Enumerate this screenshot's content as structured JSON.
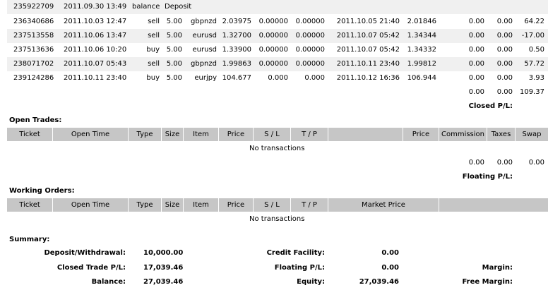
{
  "closed_trades": [
    {
      "ticket": "235922709",
      "open_time": "2011.09.30 13:49",
      "type": "balance",
      "size": "Deposit",
      "item": "",
      "price": "",
      "sl": "",
      "tp": "",
      "close_time": "",
      "close_price": "",
      "commission": "",
      "taxes": "",
      "swap": "",
      "profit": ""
    },
    {
      "ticket": "236340686",
      "open_time": "2011.10.03 12:47",
      "type": "sell",
      "size": "5.00",
      "item": "gbpnzd",
      "price": "2.03975",
      "sl": "0.00000",
      "tp": "0.00000",
      "close_time": "2011.10.05 21:40",
      "close_price": "2.01846",
      "commission": "0.00",
      "taxes": "0.00",
      "swap": "64.22"
    },
    {
      "ticket": "237513558",
      "open_time": "2011.10.06 13:47",
      "type": "sell",
      "size": "5.00",
      "item": "eurusd",
      "price": "1.32700",
      "sl": "0.00000",
      "tp": "0.00000",
      "close_time": "2011.10.07 05:42",
      "close_price": "1.34344",
      "commission": "0.00",
      "taxes": "0.00",
      "swap": "-17.00"
    },
    {
      "ticket": "237513636",
      "open_time": "2011.10.06 10:20",
      "type": "buy",
      "size": "5.00",
      "item": "eurusd",
      "price": "1.33900",
      "sl": "0.00000",
      "tp": "0.00000",
      "close_time": "2011.10.07 05:42",
      "close_price": "1.34332",
      "commission": "0.00",
      "taxes": "0.00",
      "swap": "0.50"
    },
    {
      "ticket": "238071702",
      "open_time": "2011.10.07 05:43",
      "type": "sell",
      "size": "5.00",
      "item": "gbpnzd",
      "price": "1.99863",
      "sl": "0.00000",
      "tp": "0.00000",
      "close_time": "2011.10.11 23:40",
      "close_price": "1.99812",
      "commission": "0.00",
      "taxes": "0.00",
      "swap": "57.72"
    },
    {
      "ticket": "239124286",
      "open_time": "2011.10.11 23:40",
      "type": "buy",
      "size": "5.00",
      "item": "eurjpy",
      "price": "104.677",
      "sl": "0.000",
      "tp": "0.000",
      "close_time": "2011.10.12 16:36",
      "close_price": "106.944",
      "commission": "0.00",
      "taxes": "0.00",
      "swap": "3.93"
    }
  ],
  "closed_totals": {
    "commission": "0.00",
    "taxes": "0.00",
    "swap": "109.37",
    "label": "Closed P/L:"
  },
  "open_trades": {
    "title": "Open Trades:",
    "headers": {
      "ticket": "Ticket",
      "open_time": "Open Time",
      "type": "Type",
      "size": "Size",
      "item": "Item",
      "price": "Price",
      "sl": "S / L",
      "tp": "T / P",
      "blank": "",
      "price2": "Price",
      "commission": "Commission",
      "taxes": "Taxes",
      "swap": "Swap"
    },
    "empty": "No transactions",
    "totals": {
      "commission": "0.00",
      "taxes": "0.00",
      "swap": "0.00"
    },
    "pl_label": "Floating P/L:"
  },
  "working_orders": {
    "title": "Working Orders:",
    "headers": {
      "ticket": "Ticket",
      "open_time": "Open Time",
      "type": "Type",
      "size": "Size",
      "item": "Item",
      "price": "Price",
      "sl": "S / L",
      "tp": "T / P",
      "market_price": "Market Price"
    },
    "empty": "No transactions"
  },
  "summary": {
    "title": "Summary:",
    "deposit_label": "Deposit/Withdrawal:",
    "deposit_value": "10,000.00",
    "closed_pl_label": "Closed Trade P/L:",
    "closed_pl_value": "17,039.46",
    "balance_label": "Balance:",
    "balance_value": "27,039.46",
    "credit_label": "Credit Facility:",
    "credit_value": "0.00",
    "floating_label": "Floating P/L:",
    "floating_value": "0.00",
    "equity_label": "Equity:",
    "equity_value": "27,039.46",
    "margin_label": "Margin:",
    "free_margin_label": "Free Margin:"
  }
}
